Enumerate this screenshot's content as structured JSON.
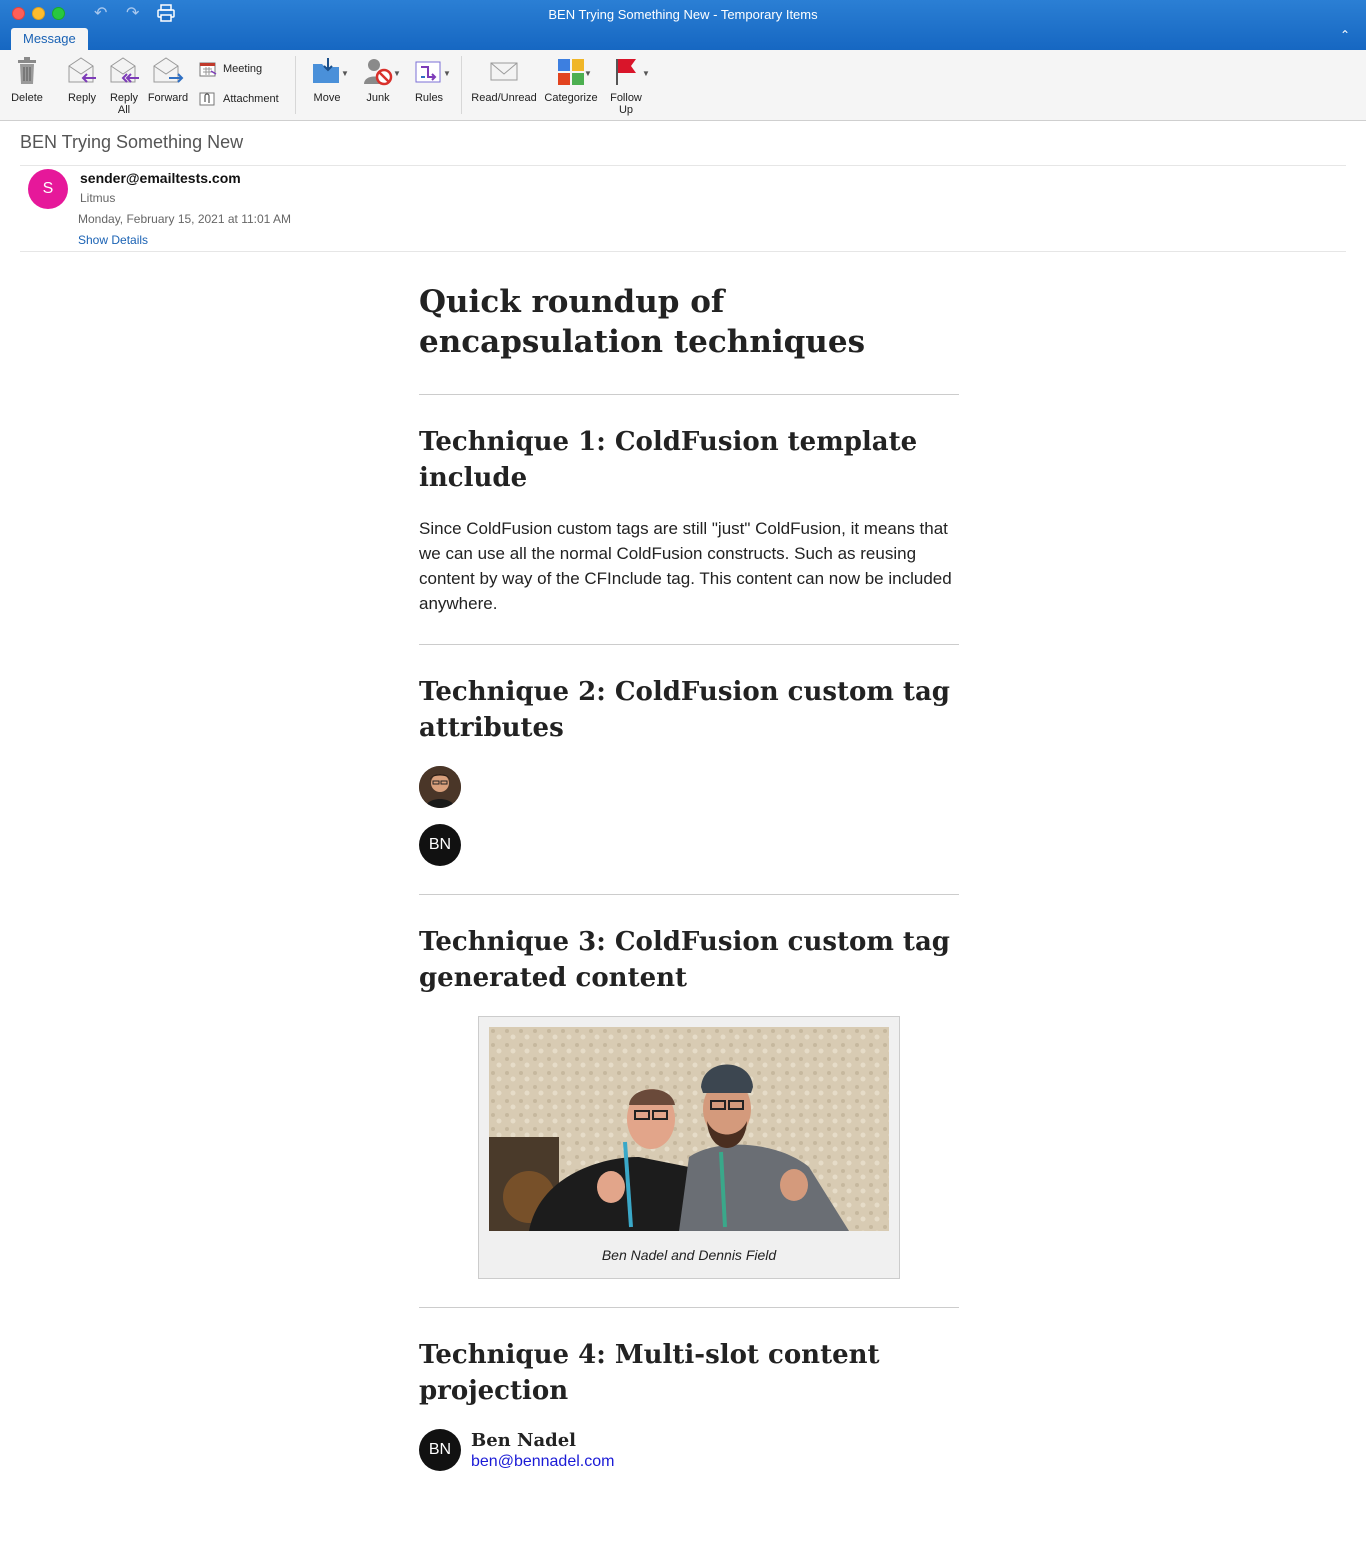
{
  "window": {
    "title": "BEN Trying Something New - Temporary Items",
    "tab": "Message"
  },
  "ribbon": {
    "delete": "Delete",
    "reply": "Reply",
    "reply_all_1": "Reply",
    "reply_all_2": "All",
    "forward": "Forward",
    "meeting": "Meeting",
    "attachment": "Attachment",
    "move": "Move",
    "junk": "Junk",
    "rules": "Rules",
    "read_unread": "Read/Unread",
    "categorize": "Categorize",
    "follow_up_1": "Follow",
    "follow_up_2": "Up"
  },
  "header": {
    "subject": "BEN Trying Something New",
    "avatar_initial": "S",
    "sender": "sender@emailtests.com",
    "org": "Litmus",
    "date": "Monday, February 15, 2021 at 11:01 AM",
    "show_details": "Show Details"
  },
  "body": {
    "title": "Quick roundup of encapsulation techniques",
    "t1_title": "Technique 1: ColdFusion template include",
    "t1_text": "Since ColdFusion custom tags are still \"just\" ColdFusion, it means that we can use all the normal ColdFusion constructs. Such as reusing content by way of the CFInclude tag. This content can now be included anywhere.",
    "t2_title": "Technique 2: ColdFusion custom tag attributes",
    "t2_initials": "BN",
    "t3_title": "Technique 3: ColdFusion custom tag generated content",
    "t3_caption": "Ben Nadel and Dennis Field",
    "t4_title": "Technique 4: Multi-slot content projection",
    "t4_initials": "BN",
    "t4_name": "Ben Nadel",
    "t4_email": "ben@bennadel.com"
  }
}
